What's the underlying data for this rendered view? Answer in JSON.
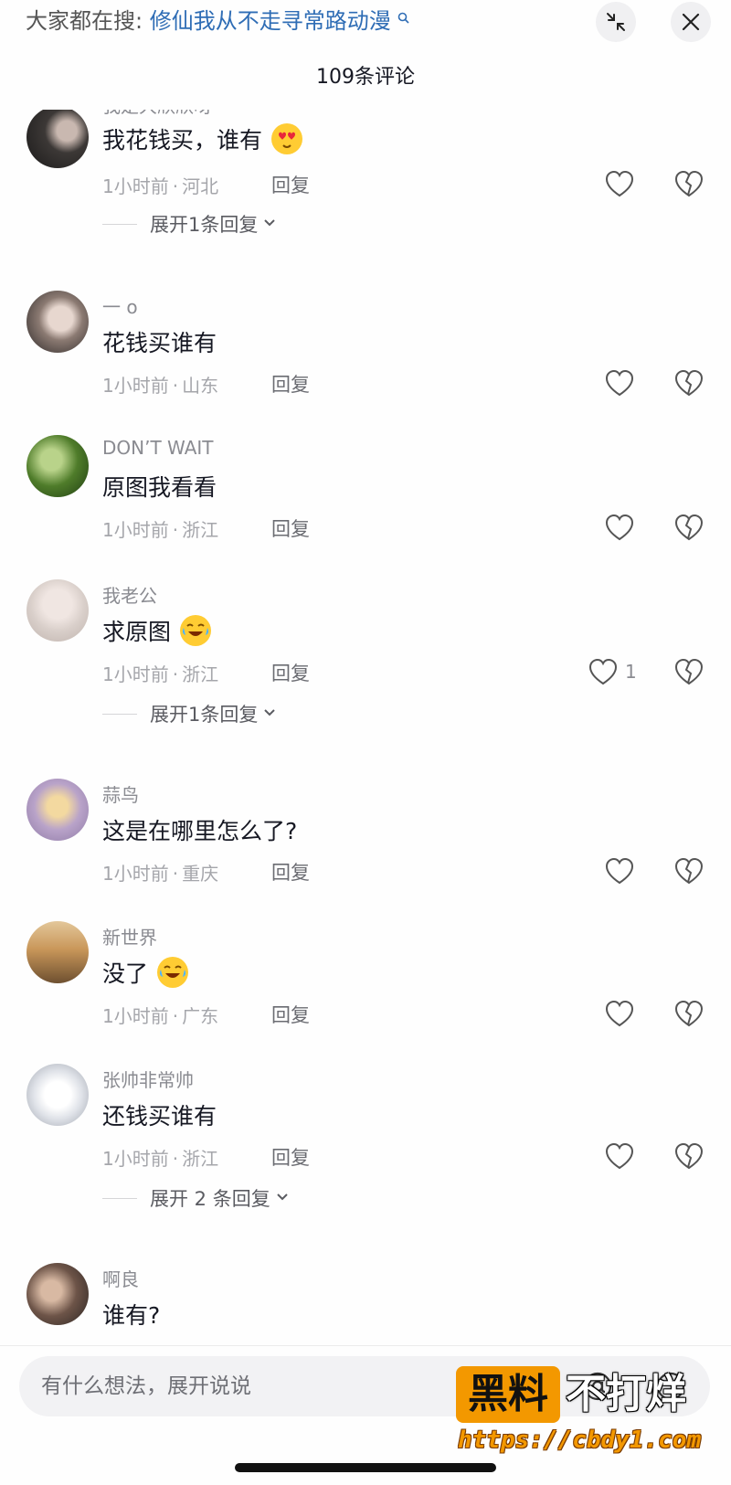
{
  "header": {
    "search_prefix": "大家都在搜:",
    "search_term": "修仙我从不走寻常路动漫",
    "comment_count": "109条评论"
  },
  "comments": [
    {
      "username": "我是大欣欣呀",
      "text": "我花钱买，谁有",
      "emoji": "heart-eyes-emoji",
      "time": "1小时前",
      "location": "河北",
      "reply": "回复",
      "likes": "",
      "expand": "展开1条回复"
    },
    {
      "username": "一 o",
      "text": "花钱买谁有",
      "emoji": "",
      "time": "1小时前",
      "location": "山东",
      "reply": "回复",
      "likes": "",
      "expand": ""
    },
    {
      "username": "DON’T WAIT",
      "text": "原图我看看",
      "emoji": "",
      "time": "1小时前",
      "location": "浙江",
      "reply": "回复",
      "likes": "",
      "expand": ""
    },
    {
      "username": "我老公",
      "text": "求原图",
      "emoji": "crying-laughing-emoji",
      "time": "1小时前",
      "location": "浙江",
      "reply": "回复",
      "likes": "1",
      "expand": "展开1条回复"
    },
    {
      "username": "蒜鸟",
      "text": "这是在哪里怎么了?",
      "emoji": "",
      "time": "1小时前",
      "location": "重庆",
      "reply": "回复",
      "likes": "",
      "expand": ""
    },
    {
      "username": "新世界",
      "text": "没了",
      "emoji": "crying-laughing-emoji",
      "time": "1小时前",
      "location": "广东",
      "reply": "回复",
      "likes": "",
      "expand": ""
    },
    {
      "username": "张帅非常帅",
      "text": "还钱买谁有",
      "emoji": "",
      "time": "1小时前",
      "location": "浙江",
      "reply": "回复",
      "likes": "",
      "expand": "展开 2 条回复"
    },
    {
      "username": "啊良",
      "text": "谁有?",
      "emoji": "",
      "time": "",
      "location": "",
      "reply": "",
      "likes": "",
      "expand": ""
    }
  ],
  "composer": {
    "placeholder": "有什么想法，展开说说"
  },
  "watermark": {
    "badge": "黑料",
    "text": "不打烊",
    "url": "https://cbdy1.com"
  },
  "colors": {
    "accent_link": "#2f6db5",
    "watermark_orange": "#f39800"
  }
}
